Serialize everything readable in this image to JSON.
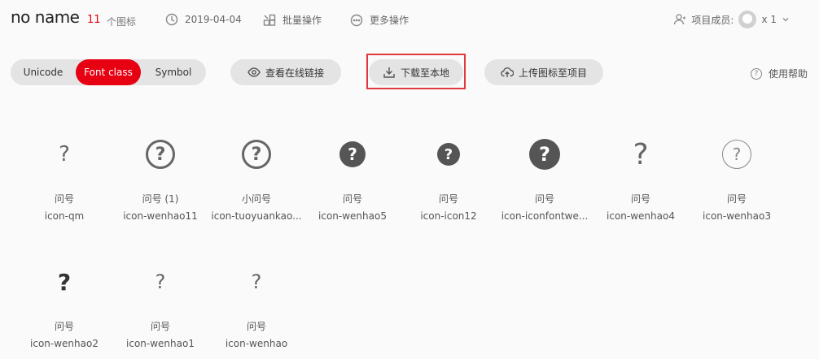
{
  "header": {
    "project_name": "no name",
    "icon_count": "11",
    "icon_count_label": "个图标",
    "date": "2019-04-04",
    "batch_ops": "批量操作",
    "more_ops": "更多操作",
    "members_label": "项目成员:",
    "members_count": "x 1"
  },
  "toolbar": {
    "tabs": [
      {
        "label": "Unicode",
        "active": false
      },
      {
        "label": "Font class",
        "active": true
      },
      {
        "label": "Symbol",
        "active": false
      }
    ],
    "view_link": "查看在线链接",
    "download": "下载至本地",
    "upload": "上传图标至项目",
    "help": "使用帮助"
  },
  "icons": [
    {
      "name": "问号",
      "code": "icon-qm",
      "style": "plain-small"
    },
    {
      "name": "问号 (1)",
      "code": "icon-wenhao11",
      "style": "ring-bold"
    },
    {
      "name": "小问号",
      "code": "icon-tuoyuankao...",
      "style": "ring-bold"
    },
    {
      "name": "问号",
      "code": "icon-wenhao5",
      "style": "fill-medium"
    },
    {
      "name": "问号",
      "code": "icon-icon12",
      "style": "fill-small"
    },
    {
      "name": "问号",
      "code": "icon-iconfontwe...",
      "style": "fill-large"
    },
    {
      "name": "问号",
      "code": "icon-wenhao4",
      "style": "plain-large"
    },
    {
      "name": "问号",
      "code": "icon-wenhao3",
      "style": "ring-thin"
    },
    {
      "name": "问号",
      "code": "icon-wenhao2",
      "style": "plain-bold"
    },
    {
      "name": "问号",
      "code": "icon-wenhao1",
      "style": "plain-small"
    },
    {
      "name": "问号",
      "code": "icon-wenhao",
      "style": "plain-small"
    }
  ],
  "colors": {
    "accent": "#e60012",
    "highlight": "#e0383c"
  }
}
